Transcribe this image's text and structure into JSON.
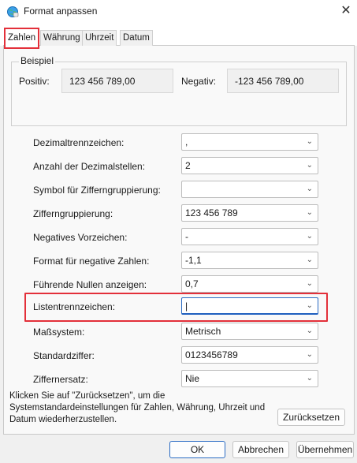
{
  "window": {
    "title": "Format anpassen",
    "app_icon": "globe-network-icon",
    "close_icon": "close-icon",
    "close_glyph": "✕"
  },
  "tabs": [
    {
      "label": "Zahlen",
      "active": true
    },
    {
      "label": "Währung",
      "active": false
    },
    {
      "label": "Uhrzeit",
      "active": false
    },
    {
      "label": "Datum",
      "active": false
    }
  ],
  "sample": {
    "group_title": "Beispiel",
    "positive_label": "Positiv:",
    "positive_value": "123 456 789,00",
    "negative_label": "Negativ:",
    "negative_value": "-123 456 789,00"
  },
  "settings": [
    {
      "label": "Dezimaltrennzeichen:",
      "value": ","
    },
    {
      "label": "Anzahl der Dezimalstellen:",
      "value": "2"
    },
    {
      "label": "Symbol für Zifferngruppierung:",
      "value": ""
    },
    {
      "label": "Zifferngruppierung:",
      "value": "123 456 789"
    },
    {
      "label": "Negatives Vorzeichen:",
      "value": "-"
    },
    {
      "label": "Format für negative Zahlen:",
      "value": "-1,1"
    },
    {
      "label": "Führende Nullen anzeigen:",
      "value": "0,7"
    },
    {
      "label": "Listentrennzeichen:",
      "value": "|"
    },
    {
      "label": "Maßsystem:",
      "value": "Metrisch"
    },
    {
      "label": "Standardziffer:",
      "value": "0123456789"
    },
    {
      "label": "Ziffernersatz:",
      "value": "Nie"
    }
  ],
  "note": "Klicken Sie auf \"Zurücksetzen\", um die Systemstandardeinstellungen für Zahlen, Währung, Uhrzeit und Datum wiederherzustellen.",
  "buttons": {
    "reset": "Zurücksetzen",
    "ok": "OK",
    "cancel": "Abbrechen",
    "apply": "Übernehmen"
  },
  "colors": {
    "highlight": "#e3303a",
    "accent": "#2b6cc4"
  }
}
